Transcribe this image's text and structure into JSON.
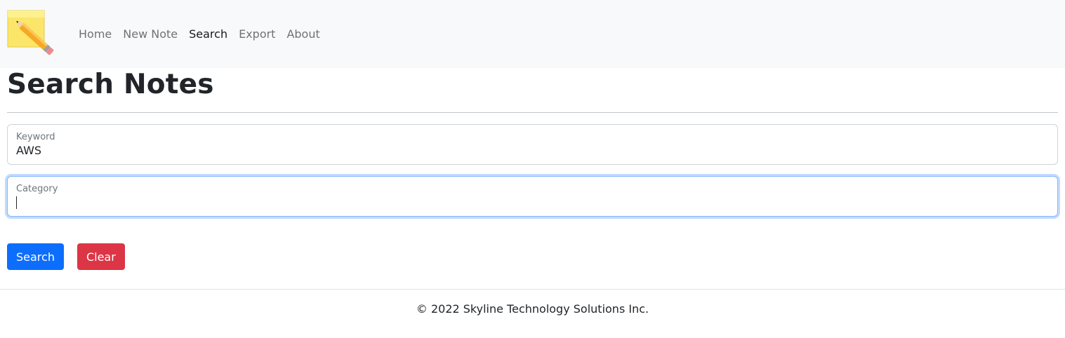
{
  "nav": {
    "logo_icon": "sticky-note-pencil-icon",
    "items": [
      {
        "label": "Home",
        "active": false
      },
      {
        "label": "New Note",
        "active": false
      },
      {
        "label": "Search",
        "active": true
      },
      {
        "label": "Export",
        "active": false
      },
      {
        "label": "About",
        "active": false
      }
    ]
  },
  "page": {
    "title": "Search Notes"
  },
  "form": {
    "keyword": {
      "label": "Keyword",
      "value": "AWS"
    },
    "category": {
      "label": "Category",
      "value": ""
    },
    "search_label": "Search",
    "clear_label": "Clear"
  },
  "footer": {
    "text": "© 2022 Skyline Technology Solutions Inc."
  },
  "colors": {
    "primary": "#0d6efd",
    "danger": "#dc3545",
    "navbar_bg": "#f8f9fa"
  }
}
